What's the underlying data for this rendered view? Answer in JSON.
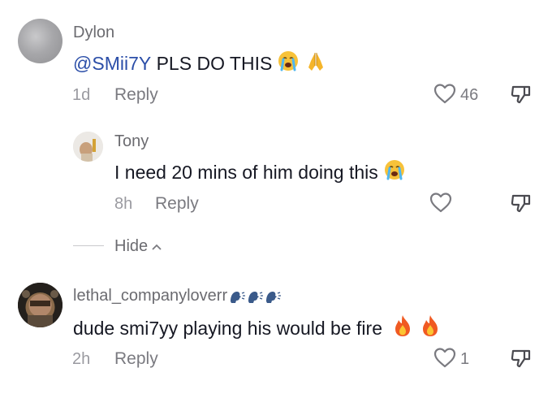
{
  "comments": [
    {
      "username": "Dylon",
      "mention": "@SMii7Y",
      "text": " PLS DO THIS",
      "emojis": [
        "loudly-crying-face",
        "folded-hands"
      ],
      "time": "1d",
      "reply_label": "Reply",
      "likes": "46"
    },
    {
      "username": "Tony",
      "text": "I need 20 mins of him doing this",
      "emojis": [
        "loudly-crying-face"
      ],
      "time": "8h",
      "reply_label": "Reply",
      "likes": ""
    },
    {
      "username": "lethal_companyloverr",
      "username_emojis": [
        "speaking-head",
        "speaking-head",
        "speaking-head"
      ],
      "text": "dude smi7yy playing his would be fire",
      "emojis": [
        "fire",
        "fire"
      ],
      "time": "2h",
      "reply_label": "Reply",
      "likes": "1"
    }
  ],
  "hide_label": "Hide",
  "colors": {
    "mention": "#2b4ea8",
    "meta": "#9a9aa0",
    "icon": "#7a7a80"
  }
}
